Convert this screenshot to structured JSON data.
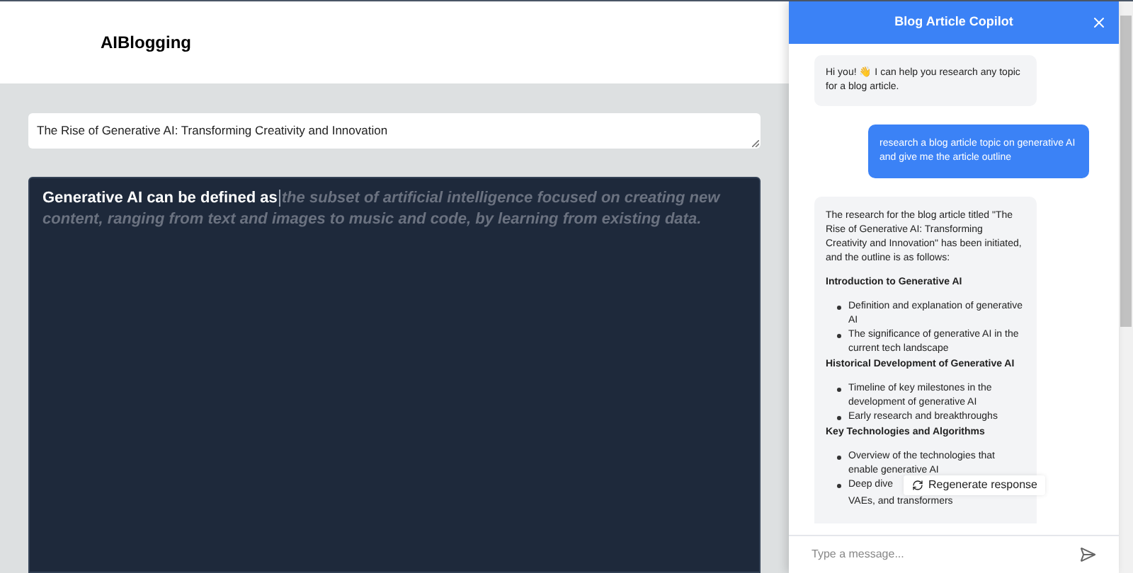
{
  "header": {
    "brand": "AIBlogging"
  },
  "title_field": {
    "value": "The Rise of Generative AI: Transforming Creativity and Innovation"
  },
  "editor": {
    "text": "Generative AI can be defined as",
    "suggestion": "the subset of artificial intelligence focused on creating new content, ranging from text and images to music and code, by learning from existing data."
  },
  "copilot": {
    "title": "Blog Article Copilot",
    "messages": [
      {
        "kind": "assistant",
        "text": "Hi you! 👋 I can help you research any topic for a blog article."
      },
      {
        "kind": "user",
        "text": "research a blog article topic on generative AI and give me the article outline"
      },
      {
        "kind": "outline",
        "intro": "The research for the blog article titled \"The Rise of Generative AI: Transforming Creativity and Innovation\" has been initiated, and the outline is as follows:",
        "sections": [
          {
            "heading": "Introduction to Generative AI",
            "bullets": [
              "Definition and explanation of generative AI",
              "The significance of generative AI in the current tech landscape"
            ]
          },
          {
            "heading": "Historical Development of Generative AI",
            "bullets": [
              "Timeline of key milestones in the development of generative AI",
              "Early research and breakthroughs"
            ]
          },
          {
            "heading": "Key Technologies and Algorithms",
            "bullets": [
              "Overview of the technologies that enable generative AI",
              "Deep dive"
            ],
            "continuation": "VAEs, and transformers"
          }
        ]
      }
    ],
    "regenerate": "Regenerate response",
    "input": {
      "placeholder": "Type a message..."
    }
  }
}
